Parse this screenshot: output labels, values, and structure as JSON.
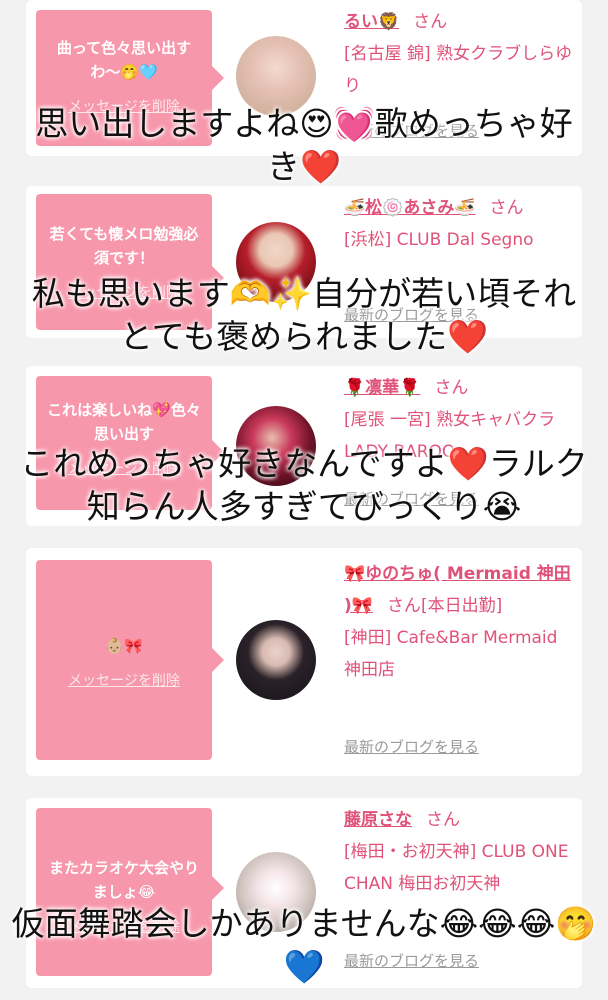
{
  "cards": [
    {
      "message": "曲って色々思い出すわ〜🤭🩵",
      "delete_label": "メッセージを削除",
      "name": "るい🦁",
      "honorific": "さん",
      "shop": "[名古屋 錦] 熟女クラブしらゆり",
      "blog_label": "最新のブログを見る"
    },
    {
      "message": "若くても懐メロ勉強必須です！",
      "delete_label": "メッセージを削除",
      "name": "🍜松🍥あさみ🍜",
      "honorific": "さん",
      "shop": "[浜松] CLUB Dal Segno",
      "blog_label": "最新のブログを見る"
    },
    {
      "message": "これは楽しいね💖色々思い出す",
      "delete_label": "メッセージを削除",
      "name": "🌹凛華🌹",
      "honorific": "さん",
      "shop": "[尾張 一宮] 熟女キャバクラ LADY BAROO",
      "blog_label": "最新のブログを見る"
    },
    {
      "message": "👶🏼🎀",
      "delete_label": "メッセージを削除",
      "name": "🎀ゆのちゅ( Mermaid 神田 )🎀",
      "honorific": "さん",
      "status": "[本日出勤]",
      "shop": "[神田] Cafe&Bar Mermaid 神田店",
      "blog_label": "最新のブログを見る"
    },
    {
      "message": "またカラオケ大会やりましょ😂",
      "delete_label": "メッセージを削除",
      "name": "藤原さな",
      "honorific": "さん",
      "shop": "[梅田・お初天神] CLUB ONE CHAN 梅田お初天神",
      "blog_label": "最新のブログを見る"
    }
  ],
  "overlays": [
    "思い出しますよね😍💓歌めっちゃ好き❤️",
    "私も思います🫶✨自分が若い頃それとても褒められました❤️",
    "これめっちゃ好きなんですよ❤️ラルク知らん人多すぎてびっくり😭",
    "仮面舞踏会しかありませんな😂😂😂🤭💙"
  ],
  "colors": {
    "bubble": "#f797ab",
    "accent": "#e0527a",
    "background": "#f2f2f2",
    "link_gray": "#9a9a9a"
  }
}
